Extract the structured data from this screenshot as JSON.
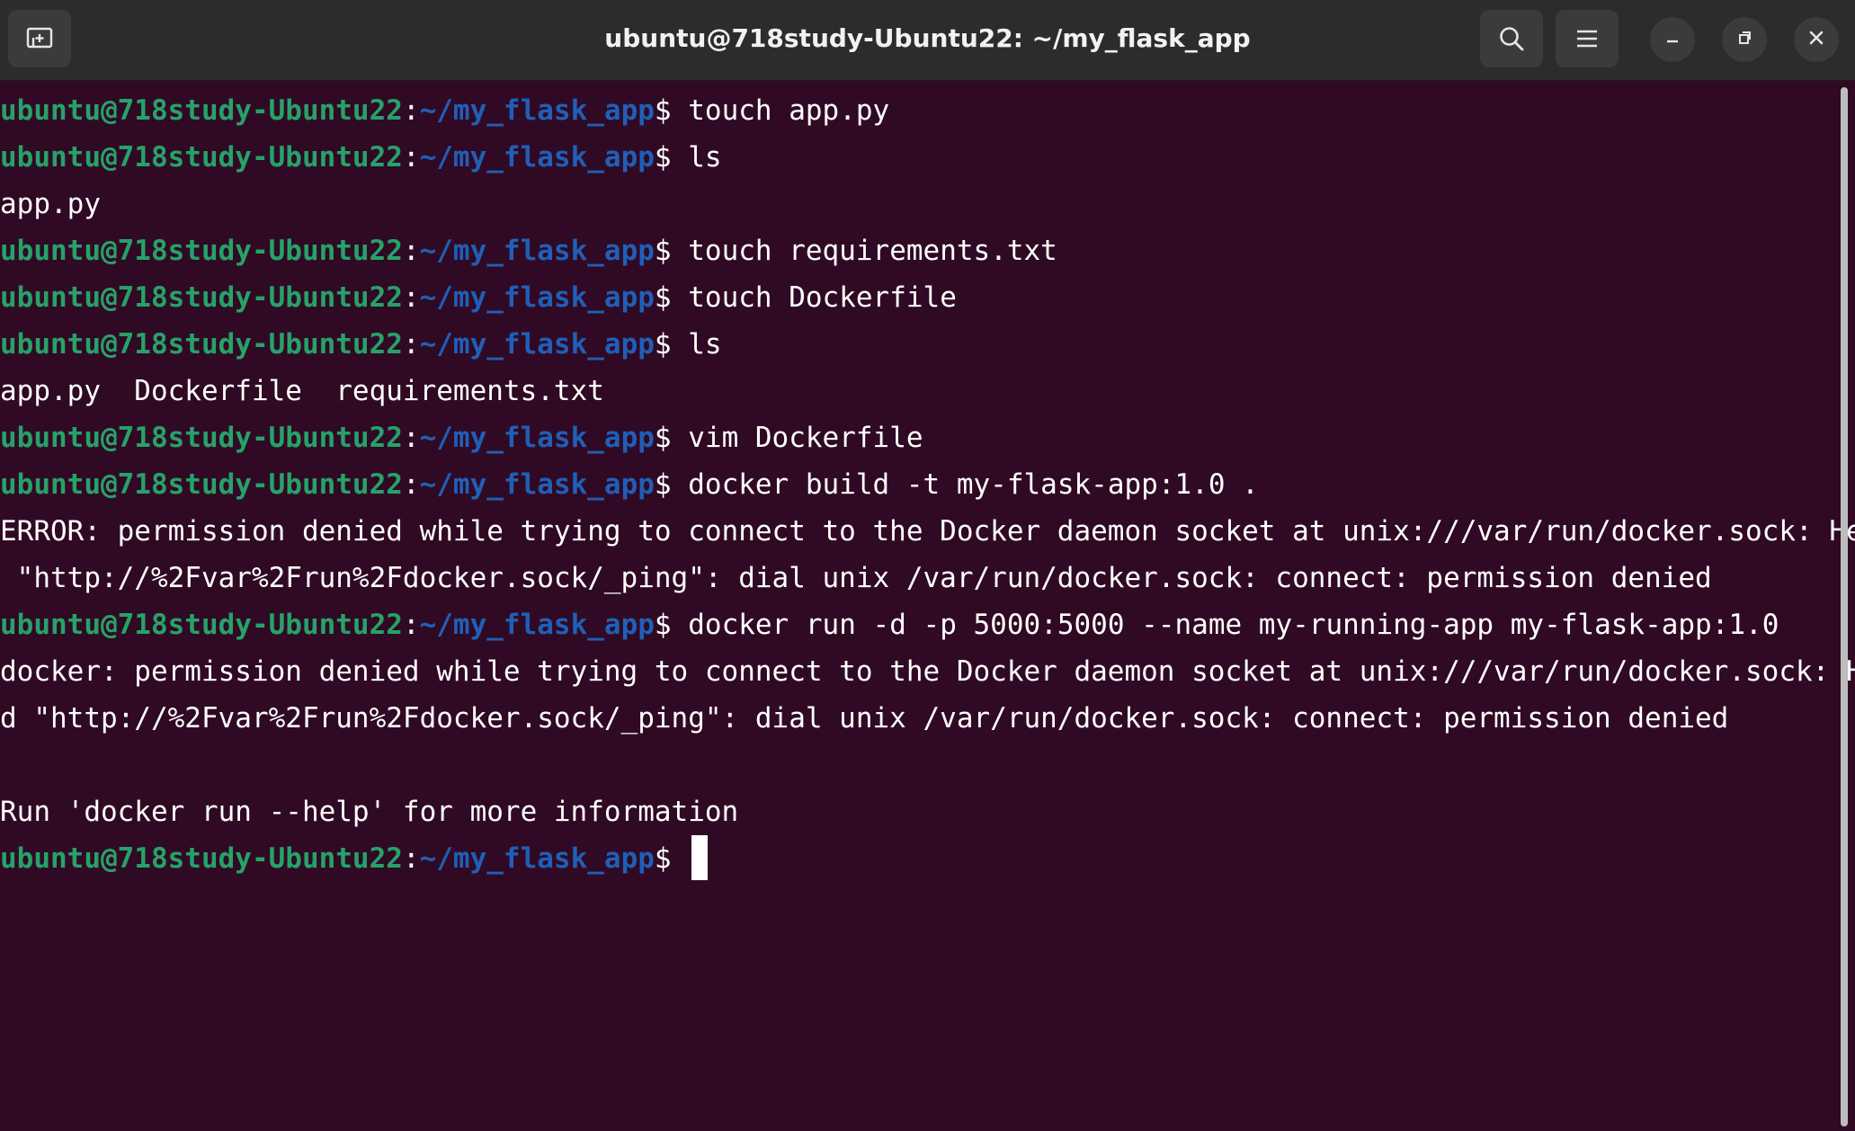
{
  "window": {
    "title": "ubuntu@718study-Ubuntu22: ~/my_flask_app"
  },
  "titlebar_icons": {
    "new_tab": "new-tab-icon",
    "search": "search-icon",
    "menu": "hamburger-menu-icon",
    "minimize": "minimize-icon",
    "maximize": "restore-icon",
    "close": "close-icon"
  },
  "prompt": {
    "user": "ubuntu@718study-Ubuntu22",
    "colon": ":",
    "path": "~/my_flask_app",
    "symbol": "$"
  },
  "lines": [
    {
      "type": "cmd",
      "text": " touch app.py"
    },
    {
      "type": "cmd",
      "text": " ls"
    },
    {
      "type": "out",
      "text": "app.py"
    },
    {
      "type": "cmd",
      "text": " touch requirements.txt"
    },
    {
      "type": "cmd",
      "text": " touch Dockerfile"
    },
    {
      "type": "cmd",
      "text": " ls"
    },
    {
      "type": "out",
      "text": "app.py  Dockerfile  requirements.txt"
    },
    {
      "type": "cmd",
      "text": " vim Dockerfile"
    },
    {
      "type": "cmd",
      "text": " docker build -t my-flask-app:1.0 ."
    },
    {
      "type": "out",
      "text": "ERROR: permission denied while trying to connect to the Docker daemon socket at unix:///var/run/docker.sock: Head"
    },
    {
      "type": "out",
      "text": " \"http://%2Fvar%2Frun%2Fdocker.sock/_ping\": dial unix /var/run/docker.sock: connect: permission denied"
    },
    {
      "type": "cmd",
      "text": " docker run -d -p 5000:5000 --name my-running-app my-flask-app:1.0"
    },
    {
      "type": "out",
      "text": "docker: permission denied while trying to connect to the Docker daemon socket at unix:///var/run/docker.sock: Hea"
    },
    {
      "type": "out",
      "text": "d \"http://%2Fvar%2Frun%2Fdocker.sock/_ping\": dial unix /var/run/docker.sock: connect: permission denied"
    },
    {
      "type": "out",
      "text": ""
    },
    {
      "type": "out",
      "text": "Run 'docker run --help' for more information"
    },
    {
      "type": "cmd",
      "text": " "
    }
  ],
  "colors": {
    "background": "#300a24",
    "titlebar": "#2c2c2c",
    "prompt_user": "#26a269",
    "prompt_path": "#1f5fb8",
    "text": "#ffffff"
  }
}
